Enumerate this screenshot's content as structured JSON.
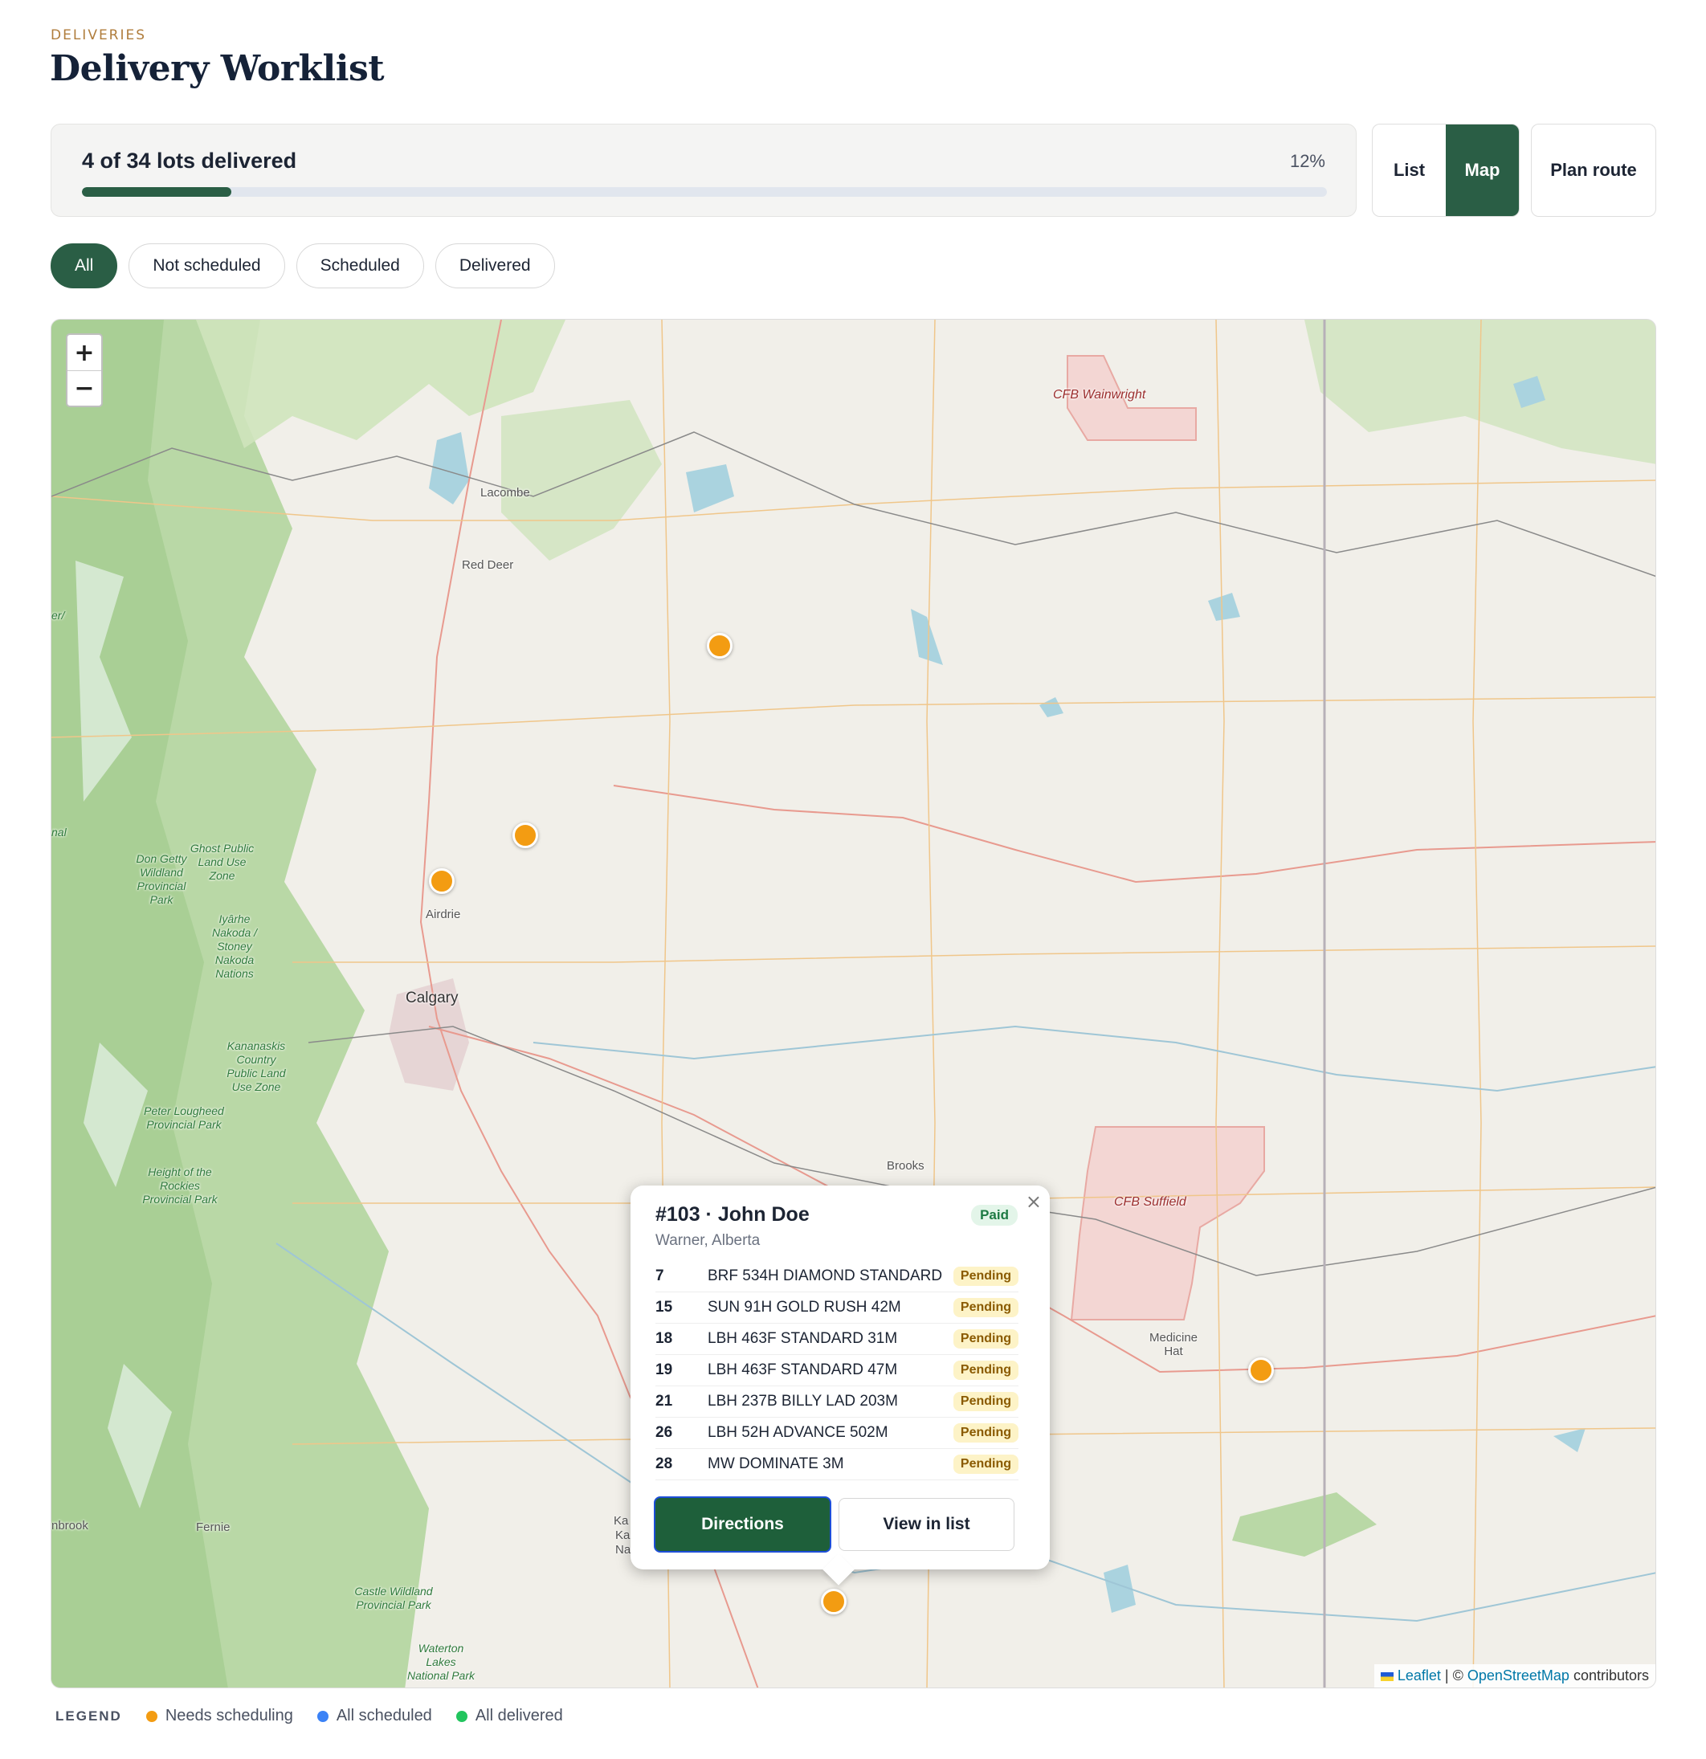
{
  "header": {
    "eyebrow": "DELIVERIES",
    "title": "Delivery Worklist"
  },
  "progress": {
    "label": "4 of 34 lots delivered",
    "percent_label": "12%",
    "delivered": 4,
    "total": 34,
    "fraction": 0.12
  },
  "view_toggle": {
    "list_label": "List",
    "map_label": "Map",
    "active": "Map"
  },
  "plan_route_label": "Plan route",
  "filters": [
    {
      "label": "All",
      "active": true
    },
    {
      "label": "Not scheduled",
      "active": false
    },
    {
      "label": "Scheduled",
      "active": false
    },
    {
      "label": "Delivered",
      "active": false
    }
  ],
  "map": {
    "zoom_in": "+",
    "zoom_out": "−",
    "places": {
      "lacombe": "Lacombe",
      "red_deer": "Red Deer",
      "airdrie": "Airdrie",
      "calgary": "Calgary",
      "brooks": "Brooks",
      "medicine_hat": "Medicine Hat",
      "fernie": "Fernie",
      "cranbrook": "nbrook",
      "cfb_wainwright": "CFB Wainwright",
      "cfb_suffield": "CFB Suffield",
      "don_getty": "Don Getty Wildland Provincial Park",
      "ghost": "Ghost Public Land Use Zone",
      "stoney": "Iyârhe Nakoda / Stoney Nakoda Nations",
      "kananaskis": "Kananaskis Country Public Land Use Zone",
      "peter_lougheed": "Peter Lougheed Provincial Park",
      "height_rockies": "Height of the Rockies Provincial Park",
      "castle": "Castle Wildland Provincial Park",
      "waterton": "Waterton Lakes National Park",
      "edge_left_1": "er/",
      "edge_left_2": "nal",
      "ka": "Ka",
      "ka2": "Ka",
      "na": "Na"
    },
    "attribution": {
      "leaflet": "Leaflet",
      "sep": "| ©",
      "osm": "OpenStreetMap",
      "suffix": "contributors"
    },
    "marker_color": "#f39c12"
  },
  "popup": {
    "title": "#103 · John Doe",
    "badge": "Paid",
    "location": "Warner, Alberta",
    "close": "×",
    "lots": [
      {
        "num": "7",
        "name": "BRF 534H DIAMOND STANDARD",
        "status": "Pending"
      },
      {
        "num": "15",
        "name": "SUN 91H GOLD RUSH 42M",
        "status": "Pending"
      },
      {
        "num": "18",
        "name": "LBH 463F STANDARD 31M",
        "status": "Pending"
      },
      {
        "num": "19",
        "name": "LBH 463F STANDARD 47M",
        "status": "Pending"
      },
      {
        "num": "21",
        "name": "LBH 237B BILLY LAD 203M",
        "status": "Pending"
      },
      {
        "num": "26",
        "name": "LBH 52H ADVANCE 502M",
        "status": "Pending"
      },
      {
        "num": "28",
        "name": "MW DOMINATE 3M",
        "status": "Pending"
      }
    ],
    "directions_label": "Directions",
    "view_in_list_label": "View in list"
  },
  "legend": {
    "title": "LEGEND",
    "items": [
      {
        "label": "Needs scheduling",
        "color": "#f39c12"
      },
      {
        "label": "All scheduled",
        "color": "#3b82f6"
      },
      {
        "label": "All delivered",
        "color": "#22c55e"
      }
    ]
  },
  "colors": {
    "accent": "#2a5e45",
    "primary_button": "#1e5f3a",
    "pending_bg": "#fdf3c7",
    "paid_bg": "#e3f5e9"
  }
}
